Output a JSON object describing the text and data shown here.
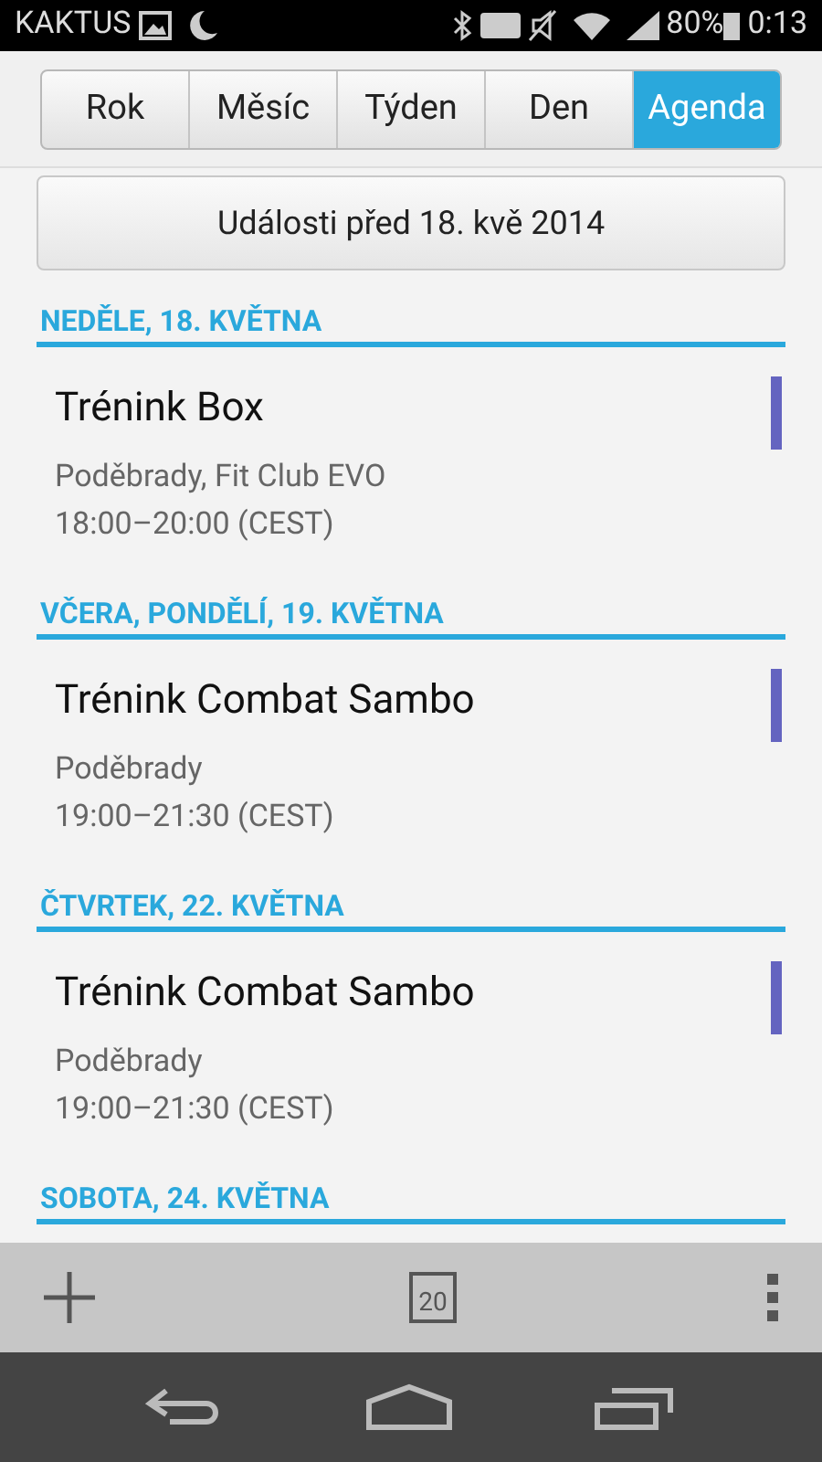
{
  "status_bar": {
    "carrier": "KAKTUS",
    "battery": "80%",
    "time": "0:13"
  },
  "tabs": [
    {
      "label": "Rok",
      "selected": false
    },
    {
      "label": "Měsíc",
      "selected": false
    },
    {
      "label": "Týden",
      "selected": false
    },
    {
      "label": "Den",
      "selected": false
    },
    {
      "label": "Agenda",
      "selected": true
    }
  ],
  "earlier_button": "Události před 18. kvě 2014",
  "days": [
    {
      "heading": "NEDĚLE, 18. KVĚTNA",
      "events": [
        {
          "title": "Trénink Box",
          "location": "Poděbrady, Fit Club EVO",
          "time": "18:00–20:00 (CEST)",
          "color": "#6464c0"
        }
      ]
    },
    {
      "heading": "VČERA, PONDĚLÍ, 19. KVĚTNA",
      "events": [
        {
          "title": "Trénink Combat Sambo",
          "location": "Poděbrady",
          "time": "19:00–21:30 (CEST)",
          "color": "#6464c0"
        }
      ]
    },
    {
      "heading": "ČTVRTEK, 22. KVĚTNA",
      "events": [
        {
          "title": "Trénink Combat Sambo",
          "location": "Poděbrady",
          "time": "19:00–21:30 (CEST)",
          "color": "#6464c0"
        }
      ]
    },
    {
      "heading": "SOBOTA, 24. KVĚTNA"
    }
  ],
  "toolbar": {
    "today_day": "20"
  }
}
